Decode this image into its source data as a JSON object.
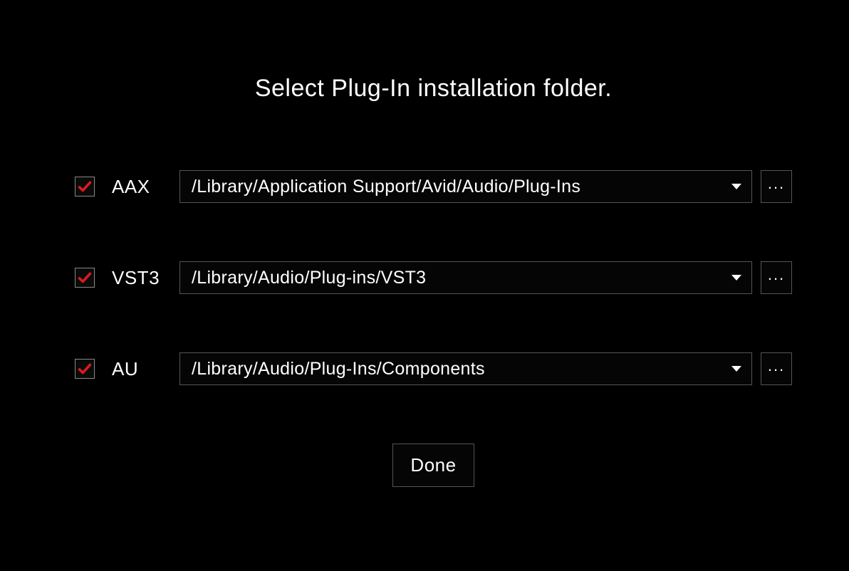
{
  "heading": "Select Plug-In installation folder.",
  "rows": [
    {
      "label": "AAX",
      "checked": true,
      "path": "/Library/Application Support/Avid/Audio/Plug-Ins"
    },
    {
      "label": "VST3",
      "checked": true,
      "path": "/Library/Audio/Plug-ins/VST3"
    },
    {
      "label": "AU",
      "checked": true,
      "path": "/Library/Audio/Plug-Ins/Components"
    }
  ],
  "browse_label": "...",
  "done_label": "Done"
}
